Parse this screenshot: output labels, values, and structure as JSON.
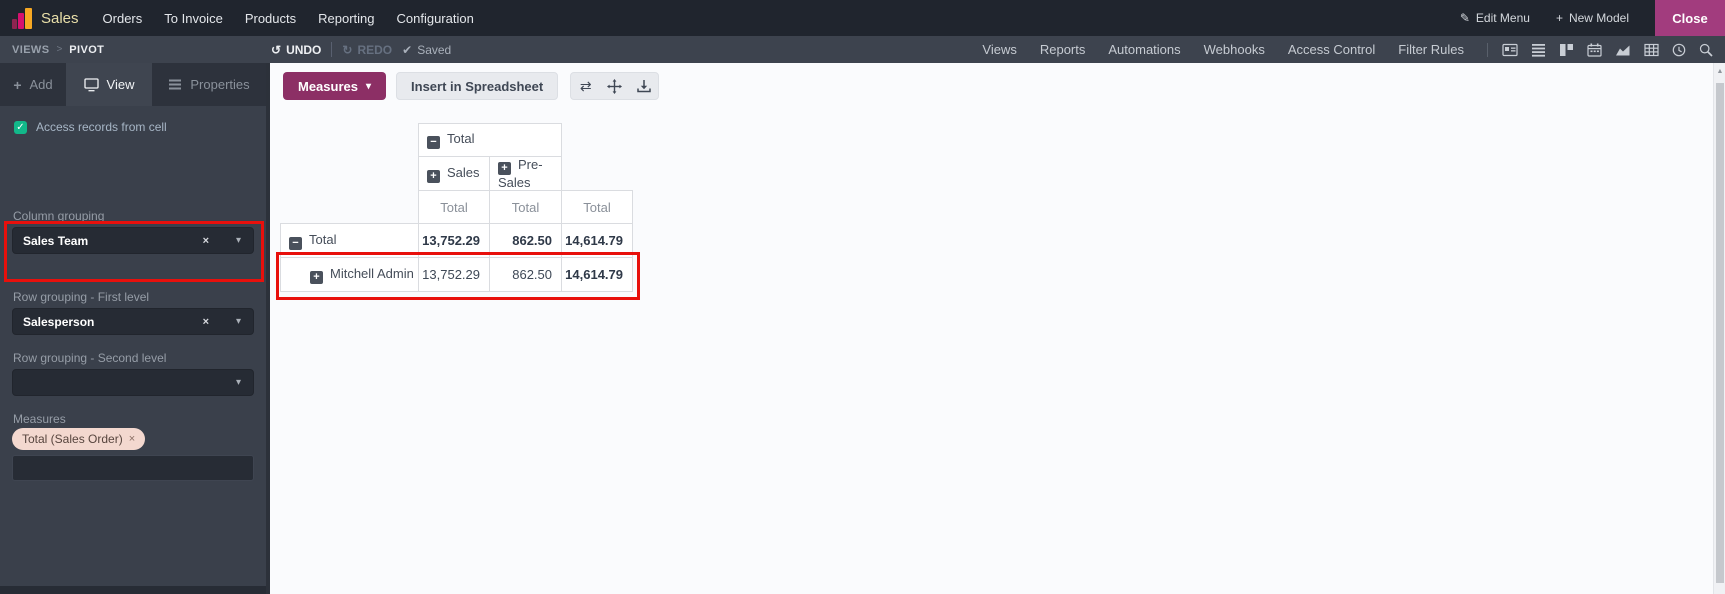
{
  "nav": {
    "app_name": "Sales",
    "items": [
      "Orders",
      "To Invoice",
      "Products",
      "Reporting",
      "Configuration"
    ],
    "edit_menu": "Edit Menu",
    "new_model": "New Model",
    "close": "Close"
  },
  "studio": {
    "breadcrumb_root": "VIEWS",
    "breadcrumb_sep": ">",
    "breadcrumb_current": "PIVOT",
    "undo": "UNDO",
    "redo": "REDO",
    "saved": "Saved",
    "menu": [
      "Views",
      "Reports",
      "Automations",
      "Webhooks",
      "Access Control",
      "Filter Rules"
    ],
    "view_icons": [
      "form-view-icon",
      "list-view-icon",
      "kanban-view-icon",
      "calendar-view-icon",
      "graph-view-icon",
      "pivot-view-icon",
      "activity-view-icon",
      "search-icon"
    ]
  },
  "sidebar": {
    "tab_add": "Add",
    "tab_view": "View",
    "tab_properties": "Properties",
    "checkbox_label": "Access records from cell",
    "column_grouping_label": "Column grouping",
    "column_grouping_value": "Sales Team",
    "row_grouping_first_label": "Row grouping - First level",
    "row_grouping_first_value": "Salesperson",
    "row_grouping_second_label": "Row grouping - Second level",
    "measures_label": "Measures",
    "measure_tag": "Total (Sales Order)"
  },
  "toolbar": {
    "measures": "Measures",
    "insert": "Insert in Spreadsheet"
  },
  "pivot": {
    "column_group": "Total",
    "column_subgroups": [
      "Sales",
      "Pre-Sales"
    ],
    "measure": "Total",
    "rows": [
      {
        "label": "Total",
        "values": [
          "13,752.29",
          "862.50",
          "14,614.79"
        ]
      },
      {
        "label": "Mitchell Admin",
        "values": [
          "13,752.29",
          "862.50",
          "14,614.79"
        ]
      }
    ]
  },
  "icons": {
    "plus": "+",
    "minus": "−",
    "caret_down": "▾",
    "close_x": "×",
    "checkmark": "✓",
    "check": "✔",
    "pencil": "✎",
    "undo": "↺",
    "redo": "↻",
    "swap": "⇄",
    "arrow_up": "▲"
  },
  "colors": {
    "accent_magenta": "#a23c7e",
    "button_magenta": "#8c2f65",
    "annotation_red": "#e8100c",
    "checkbox_teal": "#12b88a",
    "topbar_bg": "#20252e",
    "studiobar_bg": "#3d434e",
    "sidebar_bg": "#3a404b"
  }
}
